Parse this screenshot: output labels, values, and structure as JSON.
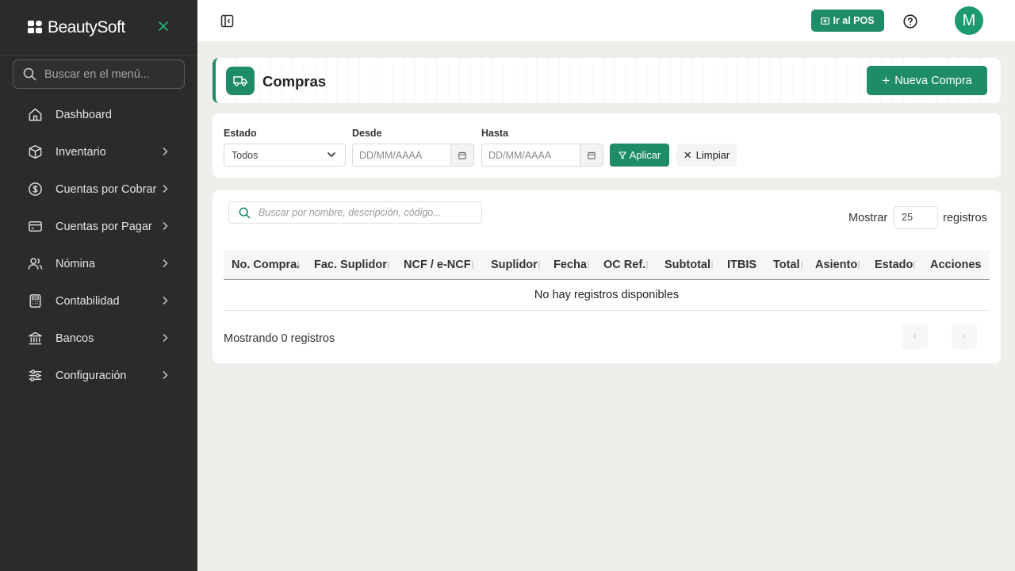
{
  "brand": {
    "name": "BeautySoft"
  },
  "sidebar": {
    "search_placeholder": "Buscar en el menú...",
    "items": [
      {
        "label": "Dashboard",
        "icon": "home-icon"
      },
      {
        "label": "Inventario",
        "icon": "box-icon"
      },
      {
        "label": "Cuentas por Cobrar",
        "icon": "dollar-circle-icon"
      },
      {
        "label": "Cuentas por Pagar",
        "icon": "credit-card-icon"
      },
      {
        "label": "Nómina",
        "icon": "users-icon"
      },
      {
        "label": "Contabilidad",
        "icon": "calculator-icon"
      },
      {
        "label": "Bancos",
        "icon": "bank-icon"
      },
      {
        "label": "Configuración",
        "icon": "sliders-icon"
      }
    ]
  },
  "topbar": {
    "pos_label": "Ir al POS",
    "avatar_initial": "M"
  },
  "page": {
    "title": "Compras",
    "new_button_label": "Nueva Compra"
  },
  "filters": {
    "estado_label": "Estado",
    "estado_value": "Todos",
    "desde_label": "Desde",
    "desde_placeholder": "DD/MM/AAAA",
    "hasta_label": "Hasta",
    "hasta_placeholder": "DD/MM/AAAA",
    "apply_label": "Aplicar",
    "clear_label": "Limpiar"
  },
  "table": {
    "search_placeholder": "Buscar por nombre, descripción, código...",
    "show_label": "Mostrar",
    "page_size": "25",
    "records_label": "registros",
    "columns": [
      "No. Compra",
      "Fac. Suplidor",
      "NCF / e-NCF",
      "Suplidor",
      "Fecha",
      "OC Ref.",
      "Subtotal",
      "ITBIS",
      "Total",
      "Asiento",
      "Estado",
      "Acciones"
    ],
    "empty_text": "No hay registros disponibles",
    "footer_text": "Mostrando 0 registros",
    "prev_symbol": "‹",
    "next_symbol": "›"
  },
  "colors": {
    "accent": "#1e8c66",
    "sidebar_bg": "#2b2b2a",
    "page_bg": "#efeeeb"
  }
}
